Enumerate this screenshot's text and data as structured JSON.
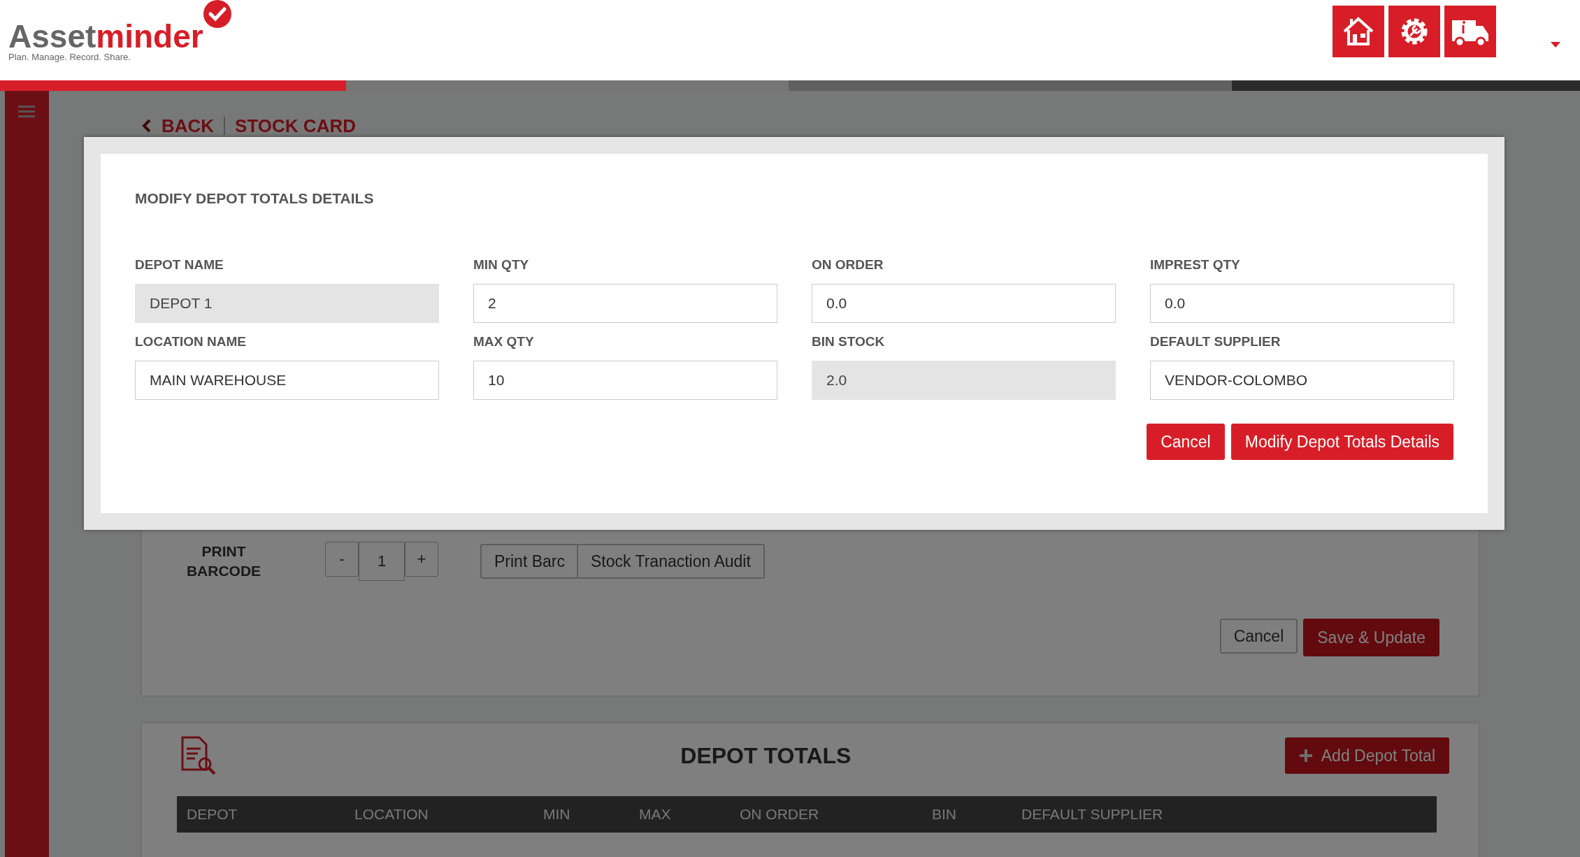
{
  "logo": {
    "text_1": "Asset",
    "text_2": "minder",
    "tagline": "Plan. Manage. Record. Share."
  },
  "breadcrumb": {
    "back": "BACK",
    "current": "STOCK CARD"
  },
  "print_barcode": {
    "label": "PRINT BARCODE",
    "minus": "-",
    "quantity": "1",
    "plus": "+",
    "buttons": [
      "Print Barc",
      "Stock Tranaction Audit"
    ]
  },
  "form_actions": {
    "cancel": "Cancel",
    "save": "Save & Update"
  },
  "depot_totals": {
    "title": "DEPOT TOTALS",
    "add_button": "Add Depot Total",
    "columns": [
      "DEPOT",
      "LOCATION",
      "MIN",
      "MAX",
      "ON ORDER",
      "BIN",
      "DEFAULT SUPPLIER"
    ]
  },
  "modal": {
    "title": "MODIFY DEPOT TOTALS DETAILS",
    "fields": [
      {
        "label": "DEPOT NAME",
        "value": "DEPOT 1",
        "disabled": true
      },
      {
        "label": "MIN QTY",
        "value": "2",
        "disabled": false
      },
      {
        "label": "ON ORDER",
        "value": "0.0",
        "disabled": false
      },
      {
        "label": "IMPREST QTY",
        "value": "0.0",
        "disabled": false
      },
      {
        "label": "LOCATION NAME",
        "value": "MAIN WAREHOUSE",
        "disabled": false
      },
      {
        "label": "MAX QTY",
        "value": "10",
        "disabled": false
      },
      {
        "label": "BIN STOCK",
        "value": "2.0",
        "disabled": true
      },
      {
        "label": "DEFAULT SUPPLIER",
        "value": "VENDOR-COLOMBO",
        "disabled": false
      }
    ],
    "cancel": "Cancel",
    "submit": "Modify Depot Totals Details"
  }
}
